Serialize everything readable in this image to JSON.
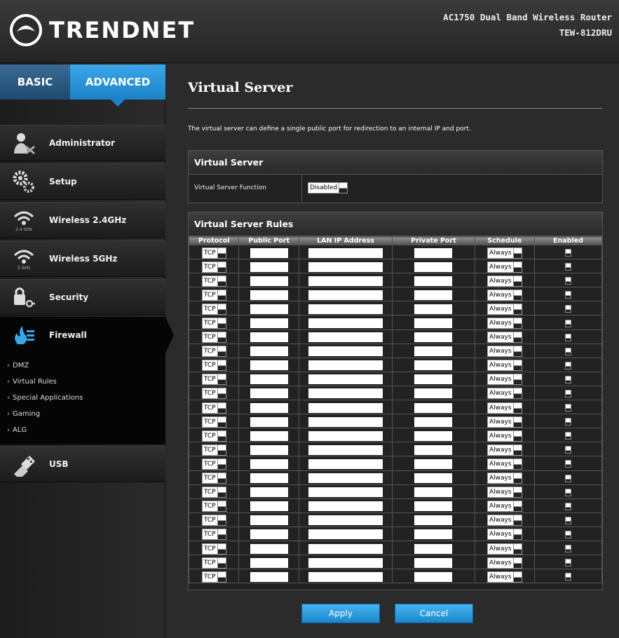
{
  "header": {
    "brand": "TRENDNET",
    "product_line": "AC1750 Dual Band Wireless Router",
    "model": "TEW-812DRU"
  },
  "tabs": [
    {
      "label": "BASIC",
      "selected": false
    },
    {
      "label": "ADVANCED",
      "selected": true
    }
  ],
  "sidebar": {
    "items": [
      {
        "label": "Administrator",
        "icon": "administrator-icon"
      },
      {
        "label": "Setup",
        "icon": "gears-icon"
      },
      {
        "label": "Wireless 2.4GHz",
        "icon": "wifi-icon",
        "icon_caption": "2.4 GHz"
      },
      {
        "label": "Wireless 5GHz",
        "icon": "wifi-icon",
        "icon_caption": "5 GHz"
      },
      {
        "label": "Security",
        "icon": "lock-key-icon"
      },
      {
        "label": "Firewall",
        "icon": "firewall-icon",
        "active": true
      },
      {
        "label": "USB",
        "icon": "usb-icon"
      }
    ],
    "firewall_submenu": [
      "DMZ",
      "Virtual Rules",
      "Special Applications",
      "Gaming",
      "ALG"
    ]
  },
  "main": {
    "title": "Virtual Server",
    "description": "The virtual server can define a single public port for redirection to an internal IP and port.",
    "vs_section": {
      "title": "Virtual Server",
      "function_label": "Virtual Server Function",
      "function_value": "Disabled"
    },
    "rules_section": {
      "title": "Virtual Server Rules",
      "columns": [
        "Protocol",
        "Public Port",
        "LAN IP Address",
        "Private Port",
        "Schedule",
        "Enabled"
      ],
      "rows": [
        {
          "protocol": "TCP",
          "schedule": "Always"
        },
        {
          "protocol": "TCP",
          "schedule": "Always"
        },
        {
          "protocol": "TCP",
          "schedule": "Always"
        },
        {
          "protocol": "TCP",
          "schedule": "Always"
        },
        {
          "protocol": "TCP",
          "schedule": "Always"
        },
        {
          "protocol": "TCP",
          "schedule": "Always"
        },
        {
          "protocol": "TCP",
          "schedule": "Always"
        },
        {
          "protocol": "TCP",
          "schedule": "Always"
        },
        {
          "protocol": "TCP",
          "schedule": "Always"
        },
        {
          "protocol": "TCP",
          "schedule": "Always"
        },
        {
          "protocol": "TCP",
          "schedule": "Always"
        },
        {
          "protocol": "TCP",
          "schedule": "Always"
        },
        {
          "protocol": "TCP",
          "schedule": "Always"
        },
        {
          "protocol": "TCP",
          "schedule": "Always"
        },
        {
          "protocol": "TCP",
          "schedule": "Always"
        },
        {
          "protocol": "TCP",
          "schedule": "Always"
        },
        {
          "protocol": "TCP",
          "schedule": "Always"
        },
        {
          "protocol": "TCP",
          "schedule": "Always"
        },
        {
          "protocol": "TCP",
          "schedule": "Always"
        },
        {
          "protocol": "TCP",
          "schedule": "Always"
        },
        {
          "protocol": "TCP",
          "schedule": "Always"
        },
        {
          "protocol": "TCP",
          "schedule": "Always"
        },
        {
          "protocol": "TCP",
          "schedule": "Always"
        },
        {
          "protocol": "TCP",
          "schedule": "Always"
        }
      ]
    },
    "buttons": {
      "apply": "Apply",
      "cancel": "Cancel"
    }
  },
  "colors": {
    "accent": "#1c82c8",
    "background": "#2b2b2b",
    "active_nav": "#050505"
  }
}
